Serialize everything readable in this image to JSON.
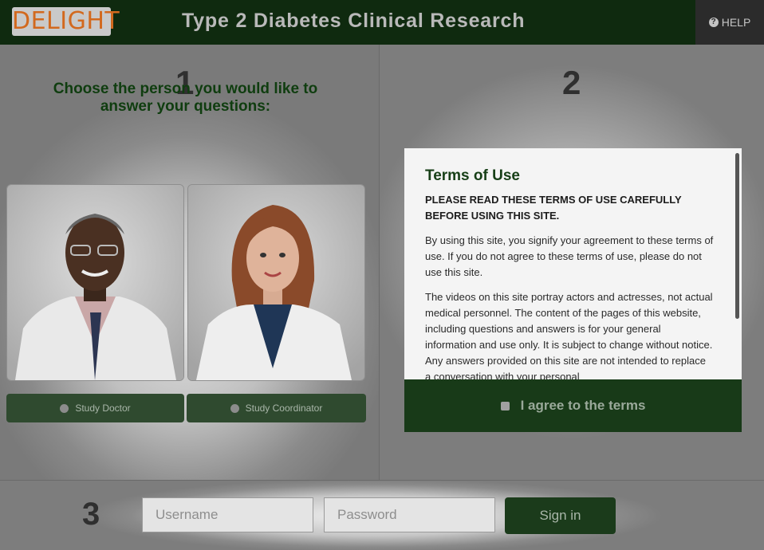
{
  "header": {
    "logo_text": "DELIGHT",
    "title": "Type 2 Diabetes Clinical Research",
    "help_label": "HELP",
    "help_icon": "question-circle-icon"
  },
  "step1": {
    "number": "1",
    "heading": "Choose the person you would like to answer your questions:",
    "options": [
      {
        "label": "Study Doctor"
      },
      {
        "label": "Study Coordinator"
      }
    ]
  },
  "step2": {
    "number": "2",
    "terms_title": "Terms of Use",
    "terms_caps": "PLEASE READ THESE TERMS OF USE CAREFULLY BEFORE USING THIS SITE.",
    "terms_p1": "By using this site, you signify your agreement to these terms of use. If you do not agree to these terms of use, please do not use this site.",
    "terms_p2": "The videos on this site portray actors and actresses, not actual medical personnel. The content of the pages of this website, including questions and answers is for your general information and use only. It is subject to change without notice. Any answers provided on this site are not intended to replace a conversation with your personal",
    "agree_label": "I agree to the terms"
  },
  "step3": {
    "number": "3",
    "username_placeholder": "Username",
    "password_placeholder": "Password",
    "signin_label": "Sign in"
  },
  "colors": {
    "header_bg": "#0f2a0f",
    "accent_green": "#173f17",
    "logo_orange": "#d2691e"
  }
}
